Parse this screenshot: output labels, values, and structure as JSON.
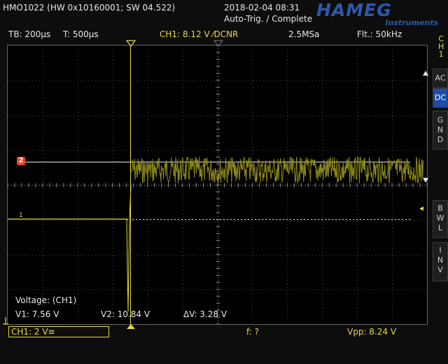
{
  "header": {
    "device": "HMO1022 (HW 0x10160001; SW 04.522)",
    "datetime": "2018-02-04 08:31",
    "status": "Auto-Trig. / Complete",
    "brand": "HAMEG",
    "brand_sub": "Instruments"
  },
  "settings": {
    "timebase": "TB: 200µs",
    "trigger_time": "T: 500µs",
    "channel": "CH1: 8.12 V ⁄DCNR",
    "sample_rate": "2.5MSa",
    "filter": "Flt.: 50kHz"
  },
  "side_menu": {
    "ch_label": [
      "C",
      "H",
      "1"
    ],
    "ac": "AC",
    "dc": "DC",
    "gnd": [
      "G",
      "N",
      "D"
    ],
    "bwl": [
      "B",
      "W",
      "L"
    ],
    "inv": [
      "I",
      "N",
      "V"
    ]
  },
  "markers": {
    "cursor2": "2",
    "ch1": "1"
  },
  "cursor_readout": {
    "title": "Voltage: (CH1)",
    "v1": "V1: 7.56 V",
    "v2": "V2: 10.84 V",
    "dv": "ΔV: 3.28 V"
  },
  "bottom": {
    "ch1_scale": "CH1: 2 V≅",
    "frequency": "f: ?",
    "vpp": "Vpp: 8.24 V"
  },
  "colors": {
    "trace": "#e5dc3c",
    "cursor_marker": "#e8462a",
    "accent": "#1e4ea6"
  }
}
